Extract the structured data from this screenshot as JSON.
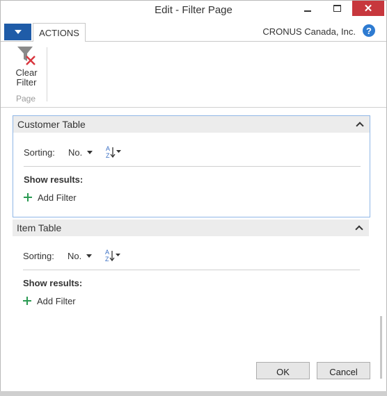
{
  "window": {
    "title": "Edit - Filter Page",
    "close_glyph": "✕"
  },
  "ribbon": {
    "tab_actions": "ACTIONS",
    "company": "CRONUS Canada, Inc.",
    "help_glyph": "?",
    "clear_filter_line1": "Clear",
    "clear_filter_line2": "Filter",
    "group_label": "Page"
  },
  "sections": [
    {
      "title": "Customer Table",
      "sorting_label": "Sorting:",
      "sorting_value": "No.",
      "show_results_label": "Show results:",
      "add_filter_label": "Add Filter"
    },
    {
      "title": "Item Table",
      "sorting_label": "Sorting:",
      "sorting_value": "No.",
      "show_results_label": "Show results:",
      "add_filter_label": "Add Filter"
    }
  ],
  "footer": {
    "ok_label": "OK",
    "cancel_label": "Cancel"
  },
  "colors": {
    "accent": "#1f5ca8",
    "close": "#c7373d",
    "add": "#2a9a52",
    "selected_border": "#8fb6e6"
  }
}
